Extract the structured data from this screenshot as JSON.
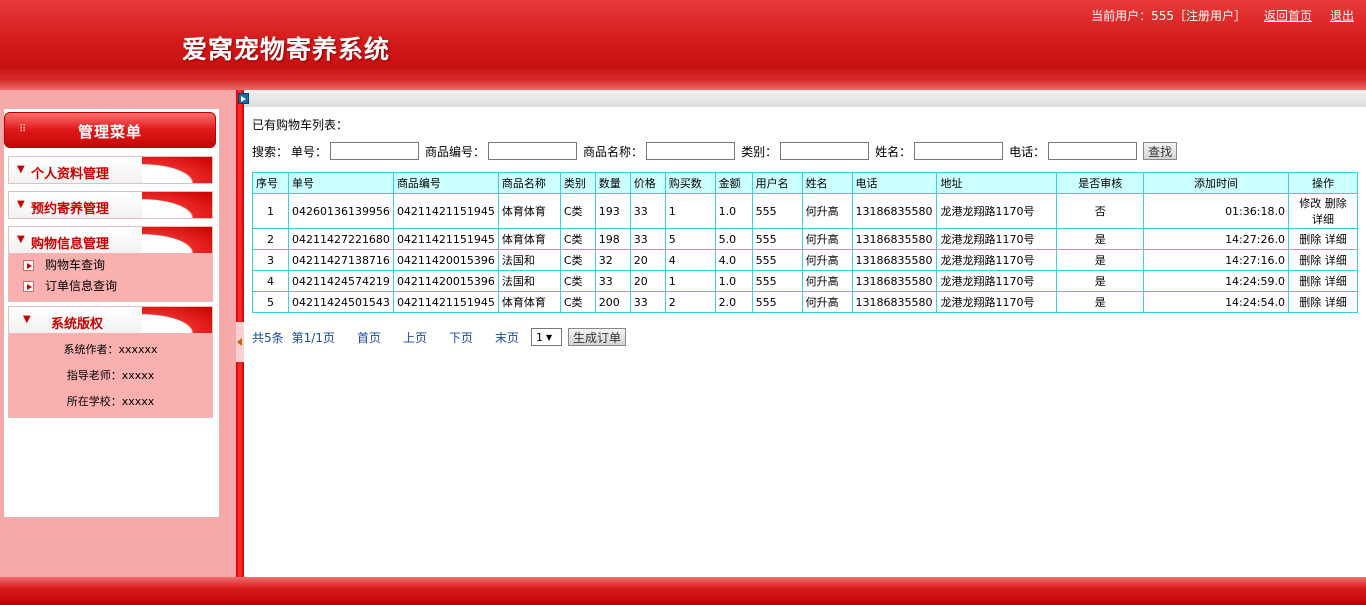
{
  "header": {
    "app_title": "爱窝宠物寄养系统",
    "current_user": "当前用户：555［注册用户］",
    "home_link": "返回首页",
    "logout_link": "退出"
  },
  "sidebar": {
    "menu_title": "管理菜单",
    "groups": [
      {
        "label": "个人资料管理"
      },
      {
        "label": "预约寄养管理"
      },
      {
        "label": "购物信息管理",
        "items": [
          {
            "label": "购物车查询"
          },
          {
            "label": "订单信息查询"
          }
        ]
      },
      {
        "label": "系统版权",
        "credits": [
          "系统作者：xxxxxx",
          "指导老师：xxxxx",
          "所在学校：xxxxx"
        ]
      }
    ]
  },
  "main": {
    "section_title": "已有购物车列表：",
    "search": {
      "prefix": "搜索：",
      "fields": [
        {
          "label": "单号：",
          "value": ""
        },
        {
          "label": "商品编号：",
          "value": ""
        },
        {
          "label": "商品名称：",
          "value": ""
        },
        {
          "label": "类别：",
          "value": ""
        },
        {
          "label": "姓名：",
          "value": ""
        },
        {
          "label": "电话：",
          "value": ""
        }
      ],
      "button": "查找"
    },
    "table": {
      "headers": [
        "序号",
        "单号",
        "商品编号",
        "商品名称",
        "类别",
        "数量",
        "价格",
        "购买数",
        "金额",
        "用户名",
        "姓名",
        "电话",
        "地址",
        "是否审核",
        "添加时间",
        "操作"
      ],
      "rows": [
        {
          "idx": "1",
          "order_no": "04260136139956",
          "goods_no": "04211421151945",
          "goods_name": "体育体育",
          "category": "C类",
          "qty": "193",
          "price": "33",
          "buy": "1",
          "amount": "1.0",
          "user": "555",
          "name": "何升高",
          "phone": "13186835580",
          "address": "龙港龙翔路1170号",
          "audited": "否",
          "time": "01:36:18.0",
          "ops": [
            "修改",
            "删除",
            "详细"
          ]
        },
        {
          "idx": "2",
          "order_no": "04211427221680",
          "goods_no": "04211421151945",
          "goods_name": "体育体育",
          "category": "C类",
          "qty": "198",
          "price": "33",
          "buy": "5",
          "amount": "5.0",
          "user": "555",
          "name": "何升高",
          "phone": "13186835580",
          "address": "龙港龙翔路1170号",
          "audited": "是",
          "time": "14:27:26.0",
          "ops": [
            "删除",
            "详细"
          ]
        },
        {
          "idx": "3",
          "order_no": "04211427138716",
          "goods_no": "04211420015396",
          "goods_name": "法国和",
          "category": "C类",
          "qty": "32",
          "price": "20",
          "buy": "4",
          "amount": "4.0",
          "user": "555",
          "name": "何升高",
          "phone": "13186835580",
          "address": "龙港龙翔路1170号",
          "audited": "是",
          "time": "14:27:16.0",
          "ops": [
            "删除",
            "详细"
          ]
        },
        {
          "idx": "4",
          "order_no": "04211424574219",
          "goods_no": "04211420015396",
          "goods_name": "法国和",
          "category": "C类",
          "qty": "33",
          "price": "20",
          "buy": "1",
          "amount": "1.0",
          "user": "555",
          "name": "何升高",
          "phone": "13186835580",
          "address": "龙港龙翔路1170号",
          "audited": "是",
          "time": "14:24:59.0",
          "ops": [
            "删除",
            "详细"
          ]
        },
        {
          "idx": "5",
          "order_no": "04211424501543",
          "goods_no": "04211421151945",
          "goods_name": "体育体育",
          "category": "C类",
          "qty": "200",
          "price": "33",
          "buy": "2",
          "amount": "2.0",
          "user": "555",
          "name": "何升高",
          "phone": "13186835580",
          "address": "龙港龙翔路1170号",
          "audited": "是",
          "time": "14:24:54.0",
          "ops": [
            "删除",
            "详细"
          ]
        }
      ]
    },
    "pager": {
      "total": "共5条",
      "page_info": "第1/1页",
      "first": "首页",
      "prev": "上页",
      "next": "下页",
      "last": "末页",
      "page_select": "1",
      "generate_button": "生成订单"
    }
  }
}
